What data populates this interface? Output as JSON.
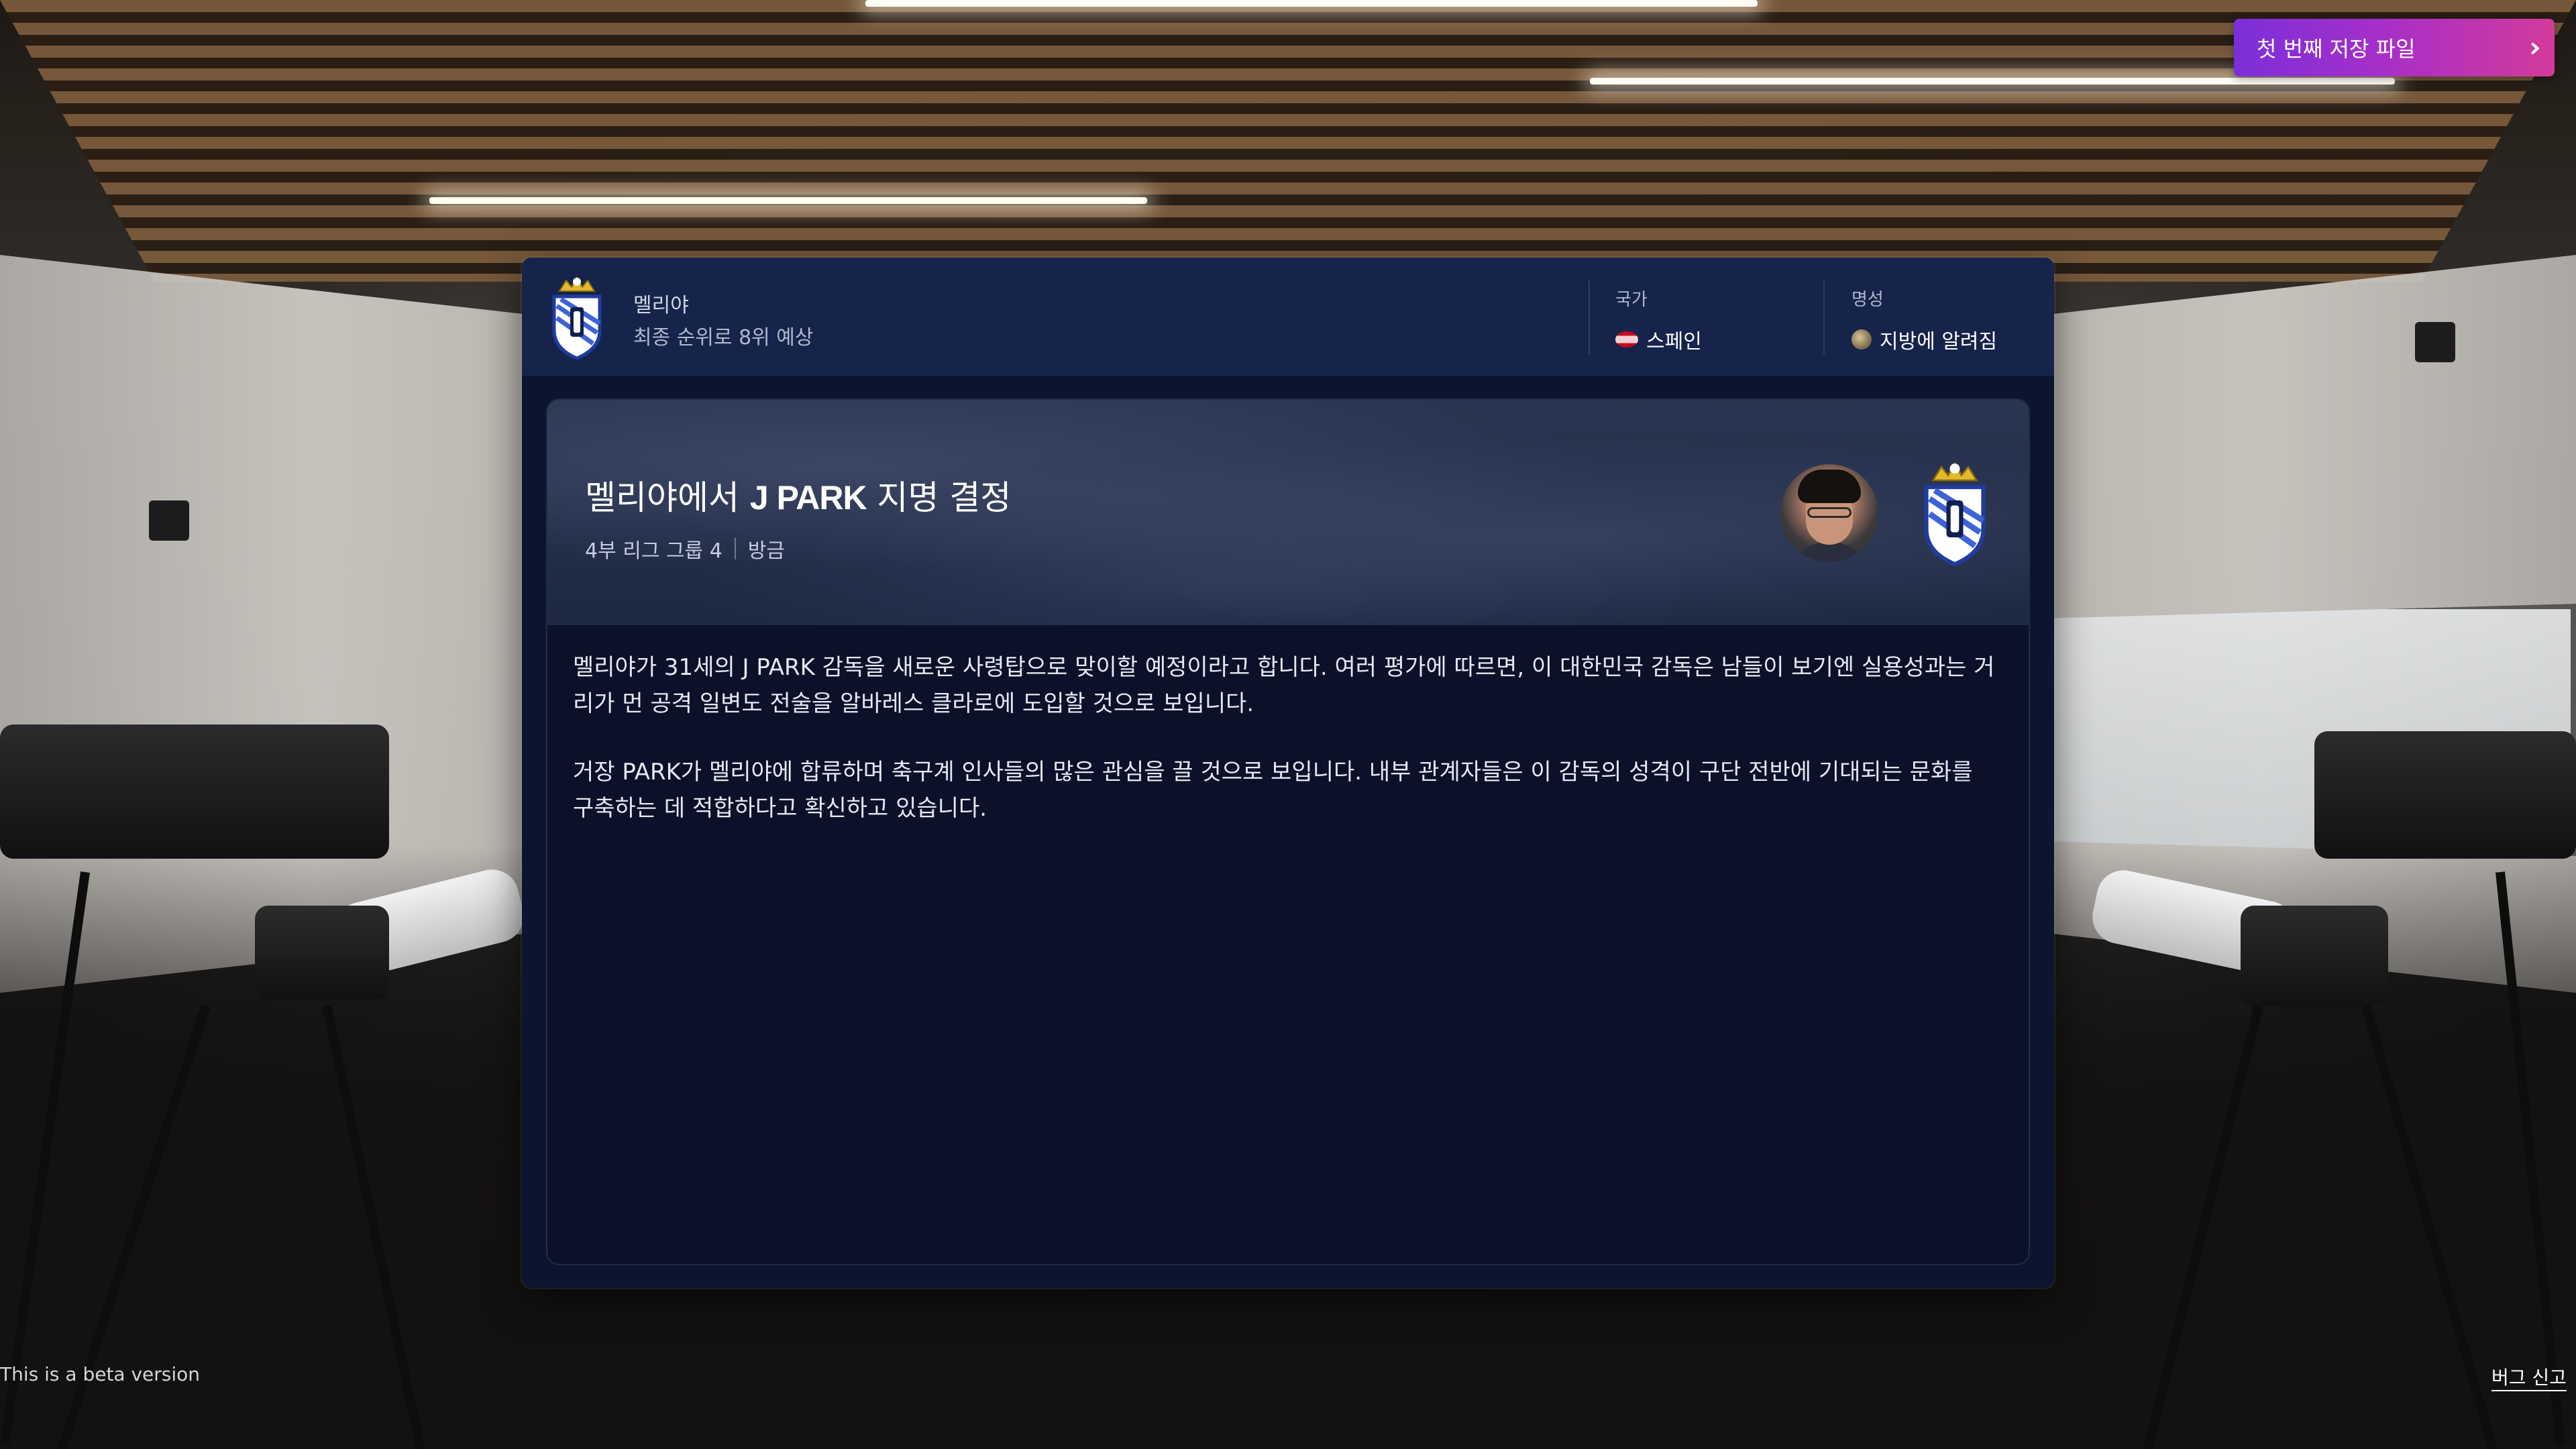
{
  "save_file": {
    "label": "첫 번째 저장 파일",
    "icon": "chevron-double-right-icon"
  },
  "club_header": {
    "club_name": "멜리야",
    "prediction": "최종 순위로 8위 예상",
    "nationality_label": "국가",
    "nationality_value": "스페인",
    "reputation_label": "명성",
    "reputation_value": "지방에 알려짐"
  },
  "news": {
    "title_prefix": "멜리야에서 ",
    "title_name": "J PARK",
    "title_suffix": " 지명 결정",
    "league": "4부 리그 그룹 4",
    "time": "방금",
    "paragraphs": [
      "멜리야가 31세의 J PARK 감독을 새로운 사령탑으로 맞이할 예정이라고 합니다. 여러 평가에 따르면, 이 대한민국 감독은 남들이 보기엔 실용성과는 거리가 먼 공격 일변도 전술을 알바레스 클라로에 도입할 것으로 보입니다.",
      "거장 PARK가 멜리야에 합류하며 축구계 인사들의 많은 관심을 끌 것으로 보입니다. 내부 관계자들은 이 감독의 성격이 구단 전반에 기대되는 문화를 구축하는 데 적합하다고 확신하고 있습니다."
    ]
  },
  "footer": {
    "beta_text": "This is a beta version",
    "bug_report": "버그 신고"
  },
  "colors": {
    "panel_bg": "#0c1530",
    "header_bg": "#16244b",
    "accent_gradient_start": "#7b2fd9",
    "accent_gradient_end": "#d43a9a"
  }
}
